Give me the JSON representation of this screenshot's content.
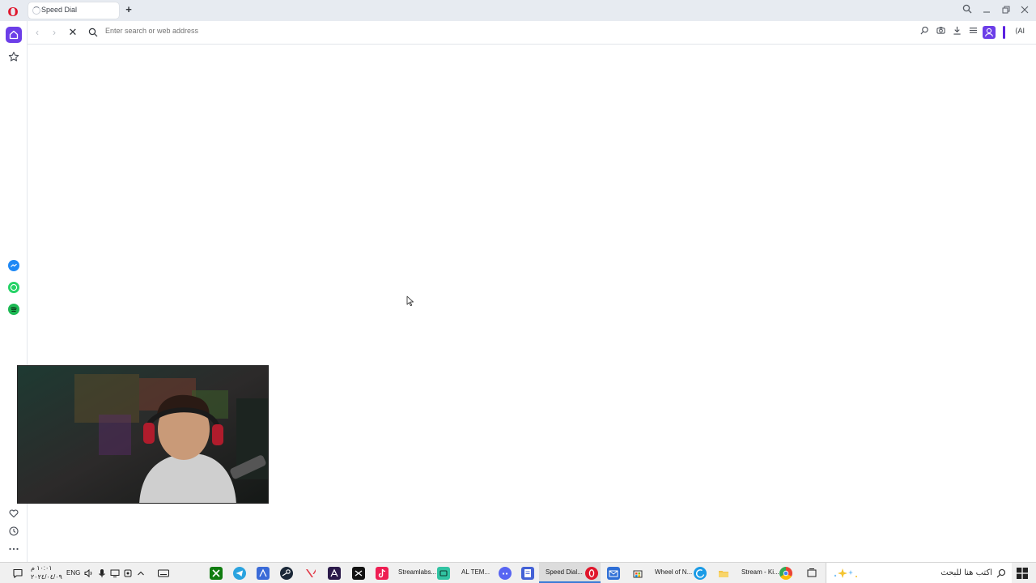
{
  "browser": {
    "tab": {
      "title": "Speed Dial"
    },
    "address": {
      "placeholder": "Enter search or web address"
    },
    "ai_label": "AI"
  },
  "sidebar": {
    "top": [
      "home-icon",
      "bookmarks-icon"
    ],
    "messengers": [
      "messenger-icon",
      "whatsapp-icon",
      "spotify-icon"
    ],
    "bottom": [
      "heart-icon",
      "history-icon",
      "more-icon"
    ]
  },
  "taskbar": {
    "clock": {
      "time": "١٠:٠١ م",
      "date": "٢٠٢٤/٠٤/٠٩"
    },
    "lang": "ENG",
    "apps": {
      "streamlabs": "Streamlabs...",
      "altem": "AL TEM...",
      "speed_dial": "Speed Dial...",
      "wheel": "Wheel of N...",
      "stream": "Stream - Ki..."
    },
    "search_placeholder": "اكتب هنا للبحث"
  },
  "colors": {
    "opera_red": "#e0152b",
    "opera_purple": "#6c3ee8",
    "messenger": "#1e88f5",
    "whatsapp": "#25d366",
    "spotify": "#1db954"
  }
}
